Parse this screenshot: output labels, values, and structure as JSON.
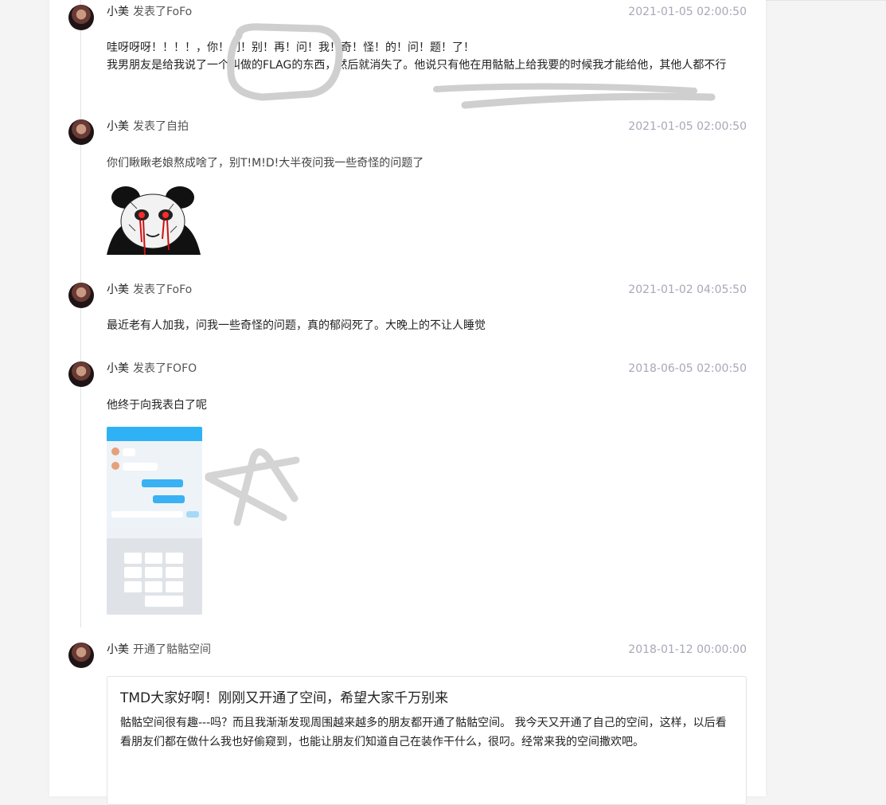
{
  "posts": [
    {
      "user": "小美",
      "action": "发表了FoFo",
      "time": "2021-01-05 02:00:50",
      "lines": [
        "哇呀呀呀！！！！，你！们！别！再！问！我！奇！怪！的！问！题！了！",
        "我男朋友是给我说了一个叫做的FLAG的东西，然后就消失了。他说只有他在用骷骷上给我要的时候我才能给他，其他人都不行"
      ]
    },
    {
      "user": "小美",
      "action": "发表了自拍",
      "time": "2021-01-05 02:00:50",
      "lines": [
        "你们瞅瞅老娘熬成啥了，别T!M!D!大半夜问我一些奇怪的问题了"
      ],
      "image": "panda-meme-image"
    },
    {
      "user": "小美",
      "action": "发表了FoFo",
      "time": "2021-01-02 04:05:50",
      "lines": [
        "最近老有人加我，问我一些奇怪的问题，真的郁闷死了。大晚上的不让人睡觉"
      ]
    },
    {
      "user": "小美",
      "action": "发表了FOFO",
      "time": "2018-06-05 02:00:50",
      "lines": [
        "他终于向我表白了呢"
      ],
      "image": "chat-screenshot-image"
    },
    {
      "user": "小美",
      "action": "开通了骷骷空间",
      "time": "2018-01-12 00:00:00",
      "article": {
        "title": "TMD大家好啊！刚刚又开通了空间，希望大家千万别来",
        "body": "骷骷空间很有趣---吗？而且我渐渐发现周围越来越多的朋友都开通了骷骷空间。 我今天又开通了自己的空间，这样，以后看看朋友们都在做什么我也好偷窥到，也能让朋友们知道自己在装作干什么，很叼。经常来我的空间撒欢吧。"
      }
    }
  ],
  "colors": {
    "time": "#a8a8b8",
    "accent_blue": "#2fb2f5",
    "scribble": "#cfcfcf"
  }
}
